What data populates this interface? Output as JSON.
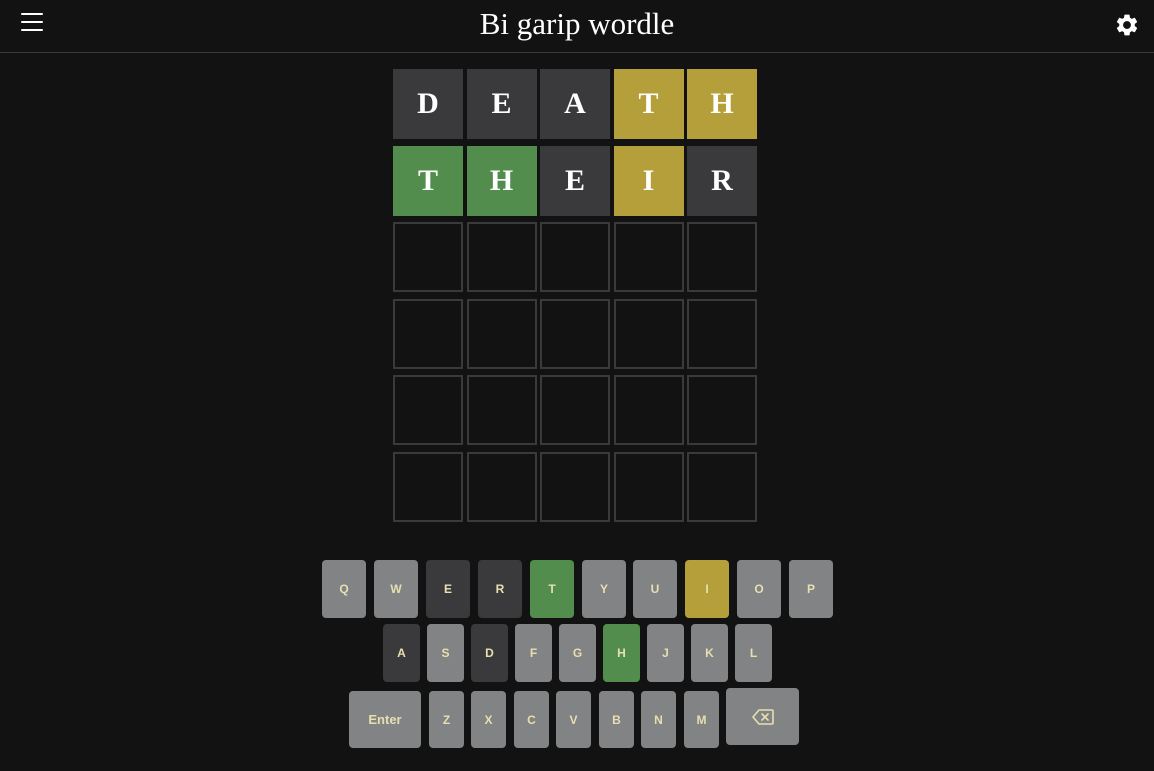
{
  "header": {
    "title": "Bi garip wordle",
    "menu_icon": "hamburger-menu-icon",
    "settings_icon": "gear-icon"
  },
  "colors": {
    "background": "#121212",
    "absent": "#3a3a3c",
    "present": "#b59f3b",
    "correct": "#538d4e",
    "unused_key": "#818384",
    "key_text": "#e8dfb0"
  },
  "board": {
    "rows": [
      {
        "tiles": [
          {
            "letter": "D",
            "state": "absent"
          },
          {
            "letter": "E",
            "state": "absent"
          },
          {
            "letter": "A",
            "state": "absent"
          },
          {
            "letter": "T",
            "state": "present"
          },
          {
            "letter": "H",
            "state": "present"
          }
        ]
      },
      {
        "tiles": [
          {
            "letter": "T",
            "state": "correct"
          },
          {
            "letter": "H",
            "state": "correct"
          },
          {
            "letter": "E",
            "state": "absent"
          },
          {
            "letter": "I",
            "state": "present"
          },
          {
            "letter": "R",
            "state": "absent"
          }
        ]
      },
      {
        "tiles": [
          {
            "letter": "",
            "state": "empty"
          },
          {
            "letter": "",
            "state": "empty"
          },
          {
            "letter": "",
            "state": "empty"
          },
          {
            "letter": "",
            "state": "empty"
          },
          {
            "letter": "",
            "state": "empty"
          }
        ]
      },
      {
        "tiles": [
          {
            "letter": "",
            "state": "empty"
          },
          {
            "letter": "",
            "state": "empty"
          },
          {
            "letter": "",
            "state": "empty"
          },
          {
            "letter": "",
            "state": "empty"
          },
          {
            "letter": "",
            "state": "empty"
          }
        ]
      },
      {
        "tiles": [
          {
            "letter": "",
            "state": "empty"
          },
          {
            "letter": "",
            "state": "empty"
          },
          {
            "letter": "",
            "state": "empty"
          },
          {
            "letter": "",
            "state": "empty"
          },
          {
            "letter": "",
            "state": "empty"
          }
        ]
      },
      {
        "tiles": [
          {
            "letter": "",
            "state": "empty"
          },
          {
            "letter": "",
            "state": "empty"
          },
          {
            "letter": "",
            "state": "empty"
          },
          {
            "letter": "",
            "state": "empty"
          },
          {
            "letter": "",
            "state": "empty"
          }
        ]
      }
    ]
  },
  "keyboard": {
    "rows": [
      {
        "keys": [
          {
            "label": "Q",
            "state": "unused"
          },
          {
            "label": "W",
            "state": "unused"
          },
          {
            "label": "E",
            "state": "absent"
          },
          {
            "label": "R",
            "state": "absent"
          },
          {
            "label": "T",
            "state": "correct"
          },
          {
            "label": "Y",
            "state": "unused"
          },
          {
            "label": "U",
            "state": "unused"
          },
          {
            "label": "I",
            "state": "present"
          },
          {
            "label": "O",
            "state": "unused"
          },
          {
            "label": "P",
            "state": "unused"
          }
        ]
      },
      {
        "keys": [
          {
            "label": "A",
            "state": "absent"
          },
          {
            "label": "S",
            "state": "unused"
          },
          {
            "label": "D",
            "state": "absent"
          },
          {
            "label": "F",
            "state": "unused"
          },
          {
            "label": "G",
            "state": "unused"
          },
          {
            "label": "H",
            "state": "correct"
          },
          {
            "label": "J",
            "state": "unused"
          },
          {
            "label": "K",
            "state": "unused"
          },
          {
            "label": "L",
            "state": "unused"
          }
        ]
      },
      {
        "keys": [
          {
            "label": "Enter",
            "state": "unused"
          },
          {
            "label": "Z",
            "state": "unused"
          },
          {
            "label": "X",
            "state": "unused"
          },
          {
            "label": "C",
            "state": "unused"
          },
          {
            "label": "V",
            "state": "unused"
          },
          {
            "label": "B",
            "state": "unused"
          },
          {
            "label": "N",
            "state": "unused"
          },
          {
            "label": "M",
            "state": "unused"
          },
          {
            "label": "",
            "state": "unused",
            "icon": "backspace-icon"
          }
        ]
      }
    ]
  }
}
